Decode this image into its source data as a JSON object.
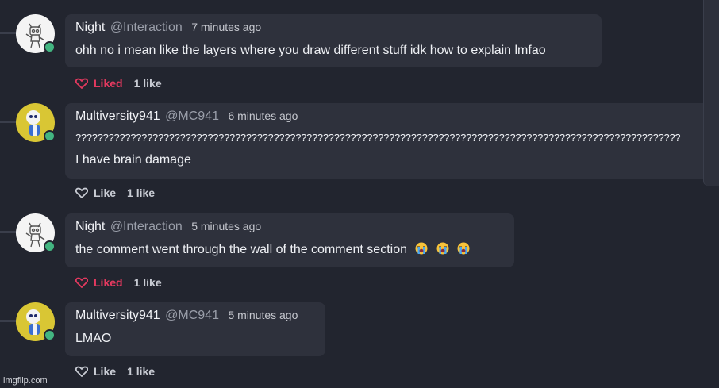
{
  "comments": [
    {
      "author": "Night",
      "handle": "@Interaction",
      "time": "7 minutes ago",
      "lines": [
        "ohh no i mean like the layers where you draw different stuff idk how to explain lmfao"
      ],
      "like_label": "Liked",
      "liked": true,
      "like_count": "1 like",
      "avatar": "robot-sketch-avatar"
    },
    {
      "author": "Multiversity941",
      "handle": "@MC941",
      "time": "6 minutes ago",
      "lines": [
        "??????????????????????????????????????????????????????????????????????????????????????????????????????????????",
        "I have brain damage"
      ],
      "like_label": "Like",
      "liked": false,
      "like_count": "1 like",
      "avatar": "skeleton-character-avatar"
    },
    {
      "author": "Night",
      "handle": "@Interaction",
      "time": "5 minutes ago",
      "lines": [
        "the comment went through the wall of the comment section"
      ],
      "emojis": [
        "loudly-crying-face",
        "loudly-crying-face",
        "loudly-crying-face"
      ],
      "like_label": "Liked",
      "liked": true,
      "like_count": "1 like",
      "avatar": "robot-sketch-avatar"
    },
    {
      "author": "Multiversity941",
      "handle": "@MC941",
      "time": "5 minutes ago",
      "lines": [
        "LMAO"
      ],
      "like_label": "Like",
      "liked": false,
      "like_count": "1 like",
      "avatar": "skeleton-character-avatar"
    }
  ],
  "colors": {
    "background": "#22252f",
    "bubble": "#2e313c",
    "liked": "#e3395f",
    "online": "#43b581"
  },
  "watermark": "imgflip.com"
}
